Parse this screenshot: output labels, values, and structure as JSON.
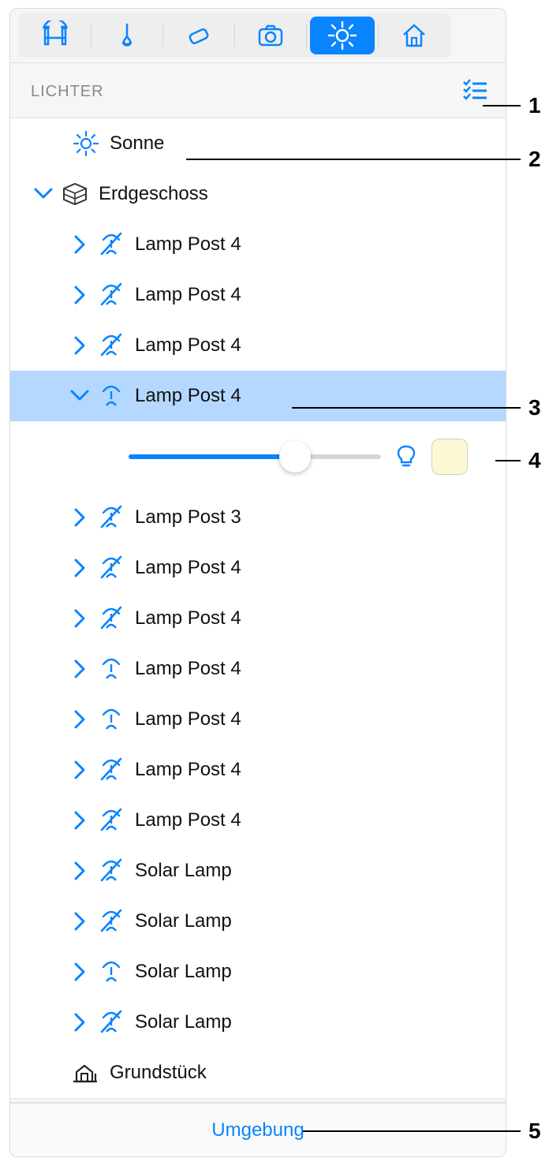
{
  "section_title": "LICHTER",
  "footer_link": "Umgebung",
  "sun_label": "Sonne",
  "group_floor": "Erdgeschoss",
  "group_lot": "Grundstück",
  "slider": {
    "value_pct": 66,
    "swatch_color": "#fdf8d4"
  },
  "items_top": [
    {
      "label": "Lamp Post 4",
      "off": true
    },
    {
      "label": "Lamp Post 4",
      "off": true
    },
    {
      "label": "Lamp Post 4",
      "off": true
    }
  ],
  "selected_item": {
    "label": "Lamp Post 4",
    "off": false
  },
  "items_bottom": [
    {
      "label": "Lamp Post 3",
      "off": true
    },
    {
      "label": "Lamp Post 4",
      "off": true
    },
    {
      "label": "Lamp Post 4",
      "off": true
    },
    {
      "label": "Lamp Post 4",
      "off": false
    },
    {
      "label": "Lamp Post 4",
      "off": false
    },
    {
      "label": "Lamp Post 4",
      "off": true
    },
    {
      "label": "Lamp Post 4",
      "off": true
    },
    {
      "label": "Solar Lamp",
      "off": true
    },
    {
      "label": "Solar Lamp",
      "off": true
    },
    {
      "label": "Solar Lamp",
      "off": false
    },
    {
      "label": "Solar Lamp",
      "off": true
    }
  ],
  "callouts": [
    "1",
    "2",
    "3",
    "4",
    "5"
  ]
}
